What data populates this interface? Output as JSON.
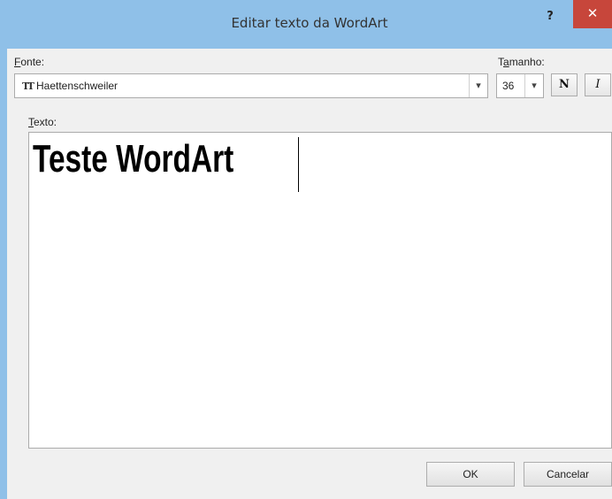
{
  "dialog": {
    "title": "Editar texto da WordArt",
    "help_label": "?",
    "close_label": "✕"
  },
  "font": {
    "label_accel": "F",
    "label_rest": "onte:",
    "value": "Haettenschweiler",
    "icon": "truetype-font-icon"
  },
  "size": {
    "label_pre": "T",
    "label_accel": "a",
    "label_rest": "manho:",
    "value": "36"
  },
  "format": {
    "bold_label": "N",
    "italic_label": "I"
  },
  "text": {
    "label_accel": "T",
    "label_rest": "exto:",
    "value": "Teste WordArt"
  },
  "buttons": {
    "ok": "OK",
    "cancel": "Cancelar"
  },
  "colors": {
    "titlebar": "#8fc0e8",
    "close": "#c7463b",
    "dialog_bg": "#f0f0f0"
  }
}
